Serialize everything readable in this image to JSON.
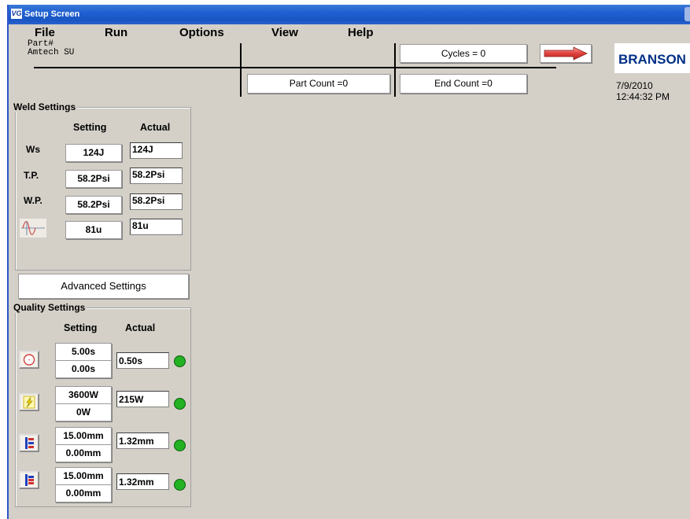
{
  "window": {
    "title": "Setup Screen",
    "app_icon_text": "VG"
  },
  "menu": [
    "File",
    "Run",
    "Options",
    "View",
    "Help"
  ],
  "header": {
    "part_label": "Part#",
    "part_value": "Amtech SU",
    "cycles": "Cycles = 0",
    "part_count": "Part Count =0",
    "end_count": "End Count =0",
    "brand": "BRANSON",
    "date": "7/9/2010",
    "time": "12:44:32 PM"
  },
  "weld_settings": {
    "title": "Weld Settings",
    "col_setting": "Setting",
    "col_actual": "Actual",
    "rows": [
      {
        "label": "Ws",
        "setting": "124J",
        "actual": "124J"
      },
      {
        "label": "T.P.",
        "setting": "58.2Psi",
        "actual": "58.2Psi"
      },
      {
        "label": "W.P.",
        "setting": "58.2Psi",
        "actual": "58.2Psi"
      },
      {
        "label": "",
        "icon": "amplitude-wave-icon",
        "setting": "81u",
        "actual": "81u"
      }
    ]
  },
  "advanced_settings_label": "Advanced Settings",
  "quality_settings": {
    "title": "Quality Settings",
    "col_setting": "Setting",
    "col_actual": "Actual",
    "rows": [
      {
        "icon": "timer-icon",
        "setting_high": "5.00s",
        "setting_low": "0.00s",
        "actual": "0.50s",
        "status_color": "#22b222"
      },
      {
        "icon": "power-icon",
        "setting_high": "3600W",
        "setting_low": "0W",
        "actual": "215W",
        "status_color": "#22b222"
      },
      {
        "icon": "collapse-distance-icon",
        "setting_high": "15.00mm",
        "setting_low": "0.00mm",
        "actual": "1.32mm",
        "status_color": "#22b222"
      },
      {
        "icon": "absolute-distance-icon",
        "setting_high": "15.00mm",
        "setting_low": "0.00mm",
        "actual": "1.32mm",
        "status_color": "#22b222"
      }
    ]
  }
}
